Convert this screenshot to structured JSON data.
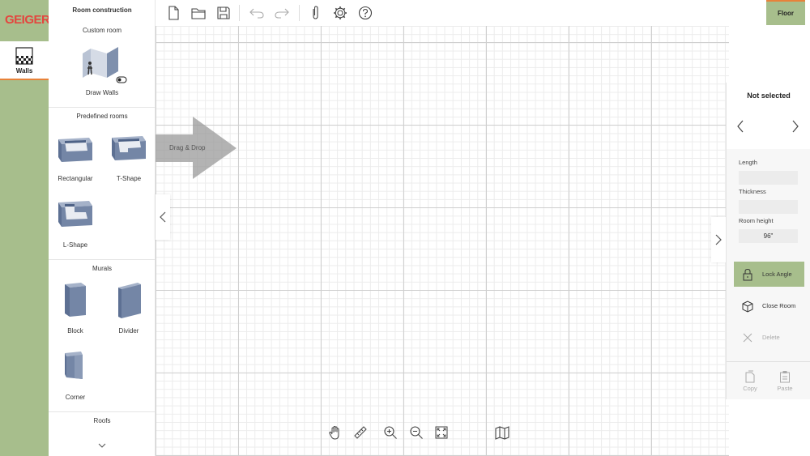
{
  "brand": {
    "logo_text": "GEIGER",
    "logo_color": "#e3463f",
    "accent": "#a7be8c",
    "highlight": "#e8823a"
  },
  "rail": {
    "walls_label": "Walls"
  },
  "catalog": {
    "title": "Room construction",
    "custom_room": {
      "heading": "Custom room",
      "draw_walls": "Draw Walls"
    },
    "predefined": {
      "heading": "Predefined rooms",
      "items": [
        "Rectangular",
        "T-Shape",
        "L-Shape"
      ]
    },
    "murals": {
      "heading": "Murals",
      "items": [
        "Block",
        "Divider",
        "Corner"
      ]
    },
    "roofs": {
      "heading": "Roofs"
    }
  },
  "toolbar": {
    "icons": [
      "new-file-icon",
      "open-folder-icon",
      "save-icon",
      "undo-icon",
      "redo-icon",
      "attach-icon",
      "settings-icon",
      "help-icon"
    ],
    "floor_tab": "Floor"
  },
  "canvas": {
    "drag_drop_label": "Drag & Drop"
  },
  "properties": {
    "title": "Not selected",
    "length_label": "Length",
    "length_value": "",
    "thickness_label": "Thickness",
    "thickness_value": "",
    "room_height_label": "Room height",
    "room_height_value": "96\"",
    "lock_angle": "Lock Angle",
    "close_room": "Close Room",
    "delete": "Delete",
    "copy": "Copy",
    "paste": "Paste"
  },
  "bottom_tools": [
    "hand-pan-icon",
    "ruler-icon",
    "zoom-in-icon",
    "zoom-out-icon",
    "fit-screen-icon",
    "map-icon"
  ]
}
